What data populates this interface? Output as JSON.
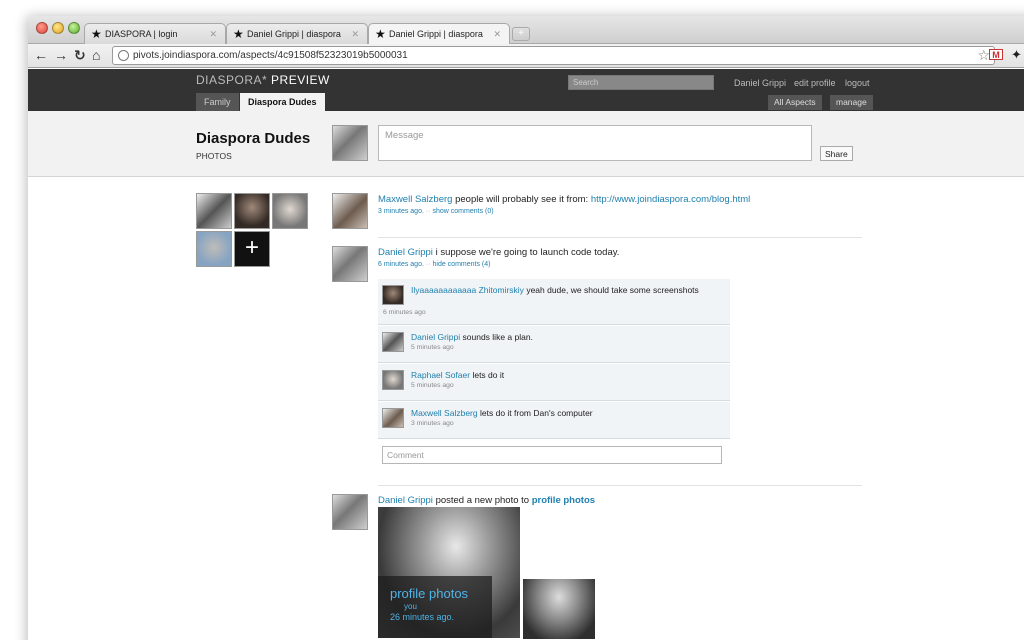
{
  "browser": {
    "tabs": [
      {
        "title": "DIASPORA | login"
      },
      {
        "title": "Daniel Grippi | diaspora"
      },
      {
        "title": "Daniel Grippi | diaspora"
      }
    ],
    "url": "pivots.joindiaspora.com/aspects/4c91508f52323019b5000031"
  },
  "header": {
    "brand": "DIASPORA*",
    "brand_suffix": "PREVIEW",
    "aspect_tabs": [
      "Family",
      "Diaspora Dudes"
    ],
    "search_placeholder": "Search",
    "user_name": "Daniel Grippi",
    "edit_profile": "edit profile",
    "logout": "logout",
    "all_aspects": "All Aspects",
    "manage": "manage"
  },
  "aspect": {
    "title": "Diaspora Dudes",
    "subtitle": "PHOTOS",
    "message_placeholder": "Message",
    "share_label": "Share"
  },
  "stream": {
    "posts": [
      {
        "author": "Maxwell Salzberg",
        "text": "people will probably see it from:",
        "link": "http://www.joindiaspora.com/blog.html",
        "time": "3 minutes ago.",
        "comments_toggle": "show comments (0)"
      },
      {
        "author": "Daniel Grippi",
        "text": "i suppose we're going to launch code today.",
        "time": "6 minutes ago.",
        "comments_toggle": "hide comments (4)"
      }
    ],
    "comments": [
      {
        "author": "Ilyaaaaaaaaaaaa Zhitomirskiy",
        "text": "yeah dude, we should take some screenshots",
        "time": "6 minutes ago"
      },
      {
        "author": "Daniel Grippi",
        "text": "sounds like a plan.",
        "time": "5 minutes ago"
      },
      {
        "author": "Raphael Sofaer",
        "text": "lets do it",
        "time": "5 minutes ago"
      },
      {
        "author": "Maxwell Salzberg",
        "text": "lets do it from Dan's computer",
        "time": "3 minutes ago"
      }
    ],
    "comment_placeholder": "Comment",
    "photo_post": {
      "author": "Daniel Grippi",
      "text": "posted a new photo to",
      "album": "profile photos",
      "overlay_title": "profile photos",
      "overlay_by": "you",
      "overlay_time": "26 minutes ago."
    }
  },
  "separator": "··"
}
